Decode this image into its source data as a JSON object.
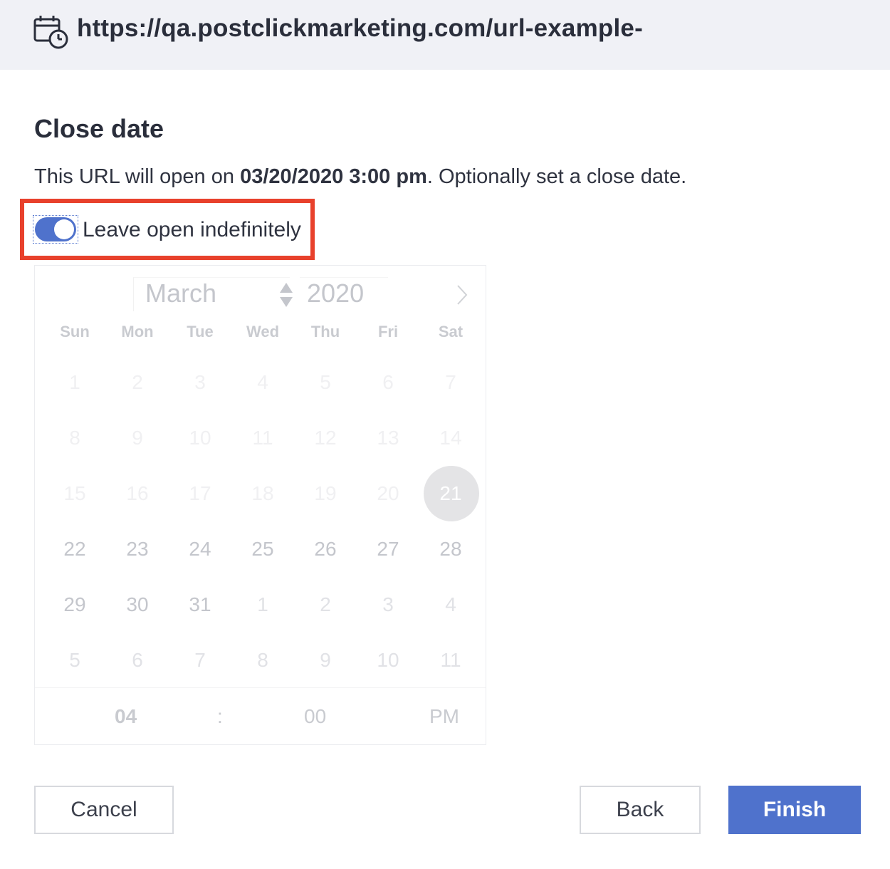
{
  "header": {
    "icon": "calendar-clock-icon",
    "url": "https://qa.postclickmarketing.com/url-example-"
  },
  "section": {
    "title": "Close date",
    "desc_prefix": "This URL will open on ",
    "desc_date": "03/20/2020 3:00 pm",
    "desc_suffix": ". Optionally set a close date."
  },
  "toggle": {
    "label": "Leave open indefinitely",
    "checked": true,
    "accent": "#4f72cc"
  },
  "calendar": {
    "month": "March",
    "year": "2020",
    "weekdays": [
      "Sun",
      "Mon",
      "Tue",
      "Wed",
      "Thu",
      "Fri",
      "Sat"
    ],
    "weeks": [
      [
        "1",
        "2",
        "3",
        "4",
        "5",
        "6",
        "7"
      ],
      [
        "8",
        "9",
        "10",
        "11",
        "12",
        "13",
        "14"
      ],
      [
        "15",
        "16",
        "17",
        "18",
        "19",
        "20",
        "21"
      ],
      [
        "22",
        "23",
        "24",
        "25",
        "26",
        "27",
        "28"
      ],
      [
        "29",
        "30",
        "31",
        "1",
        "2",
        "3",
        "4"
      ],
      [
        "5",
        "6",
        "7",
        "8",
        "9",
        "10",
        "11"
      ]
    ],
    "today": "21",
    "time": {
      "hour": "04",
      "separator": ":",
      "minute": "00",
      "ampm": "PM"
    }
  },
  "buttons": {
    "cancel": "Cancel",
    "back": "Back",
    "finish": "Finish"
  },
  "colors": {
    "highlight": "#e8412c",
    "primary": "#4f72cc"
  }
}
